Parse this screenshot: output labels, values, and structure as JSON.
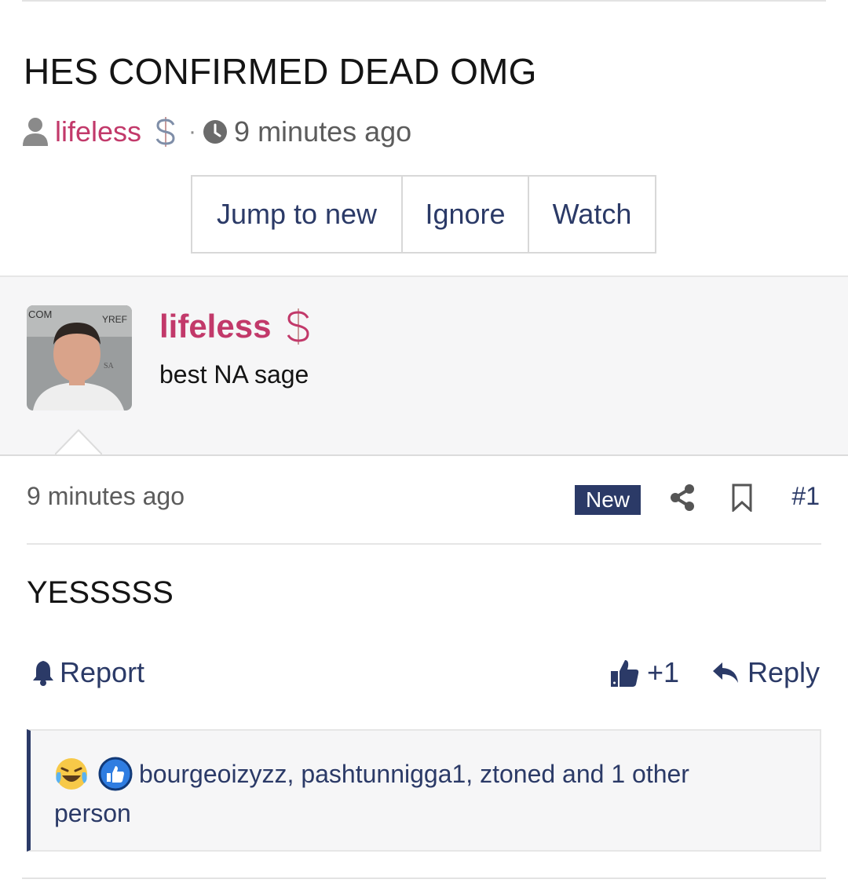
{
  "thread": {
    "title": "HES CONFIRMED DEAD OMG",
    "author": "lifeless",
    "time": "9 minutes ago",
    "separator": "·"
  },
  "buttons": {
    "jump": "Jump to new",
    "ignore": "Ignore",
    "watch": "Watch"
  },
  "user": {
    "name": "lifeless",
    "title": "best NA sage"
  },
  "post": {
    "time": "9 minutes ago",
    "badge": "New",
    "number": "#1",
    "body": "YESSSSS",
    "report_label": "Report",
    "like_count": "+1",
    "reply_label": "Reply"
  },
  "reactions": {
    "text": "bourgeoizyzz, pashtunnigga1, ztoned and 1 other person"
  },
  "colors": {
    "accent": "#2b3a67",
    "username": "#c2396a",
    "panel_bg": "#f6f6f7"
  }
}
